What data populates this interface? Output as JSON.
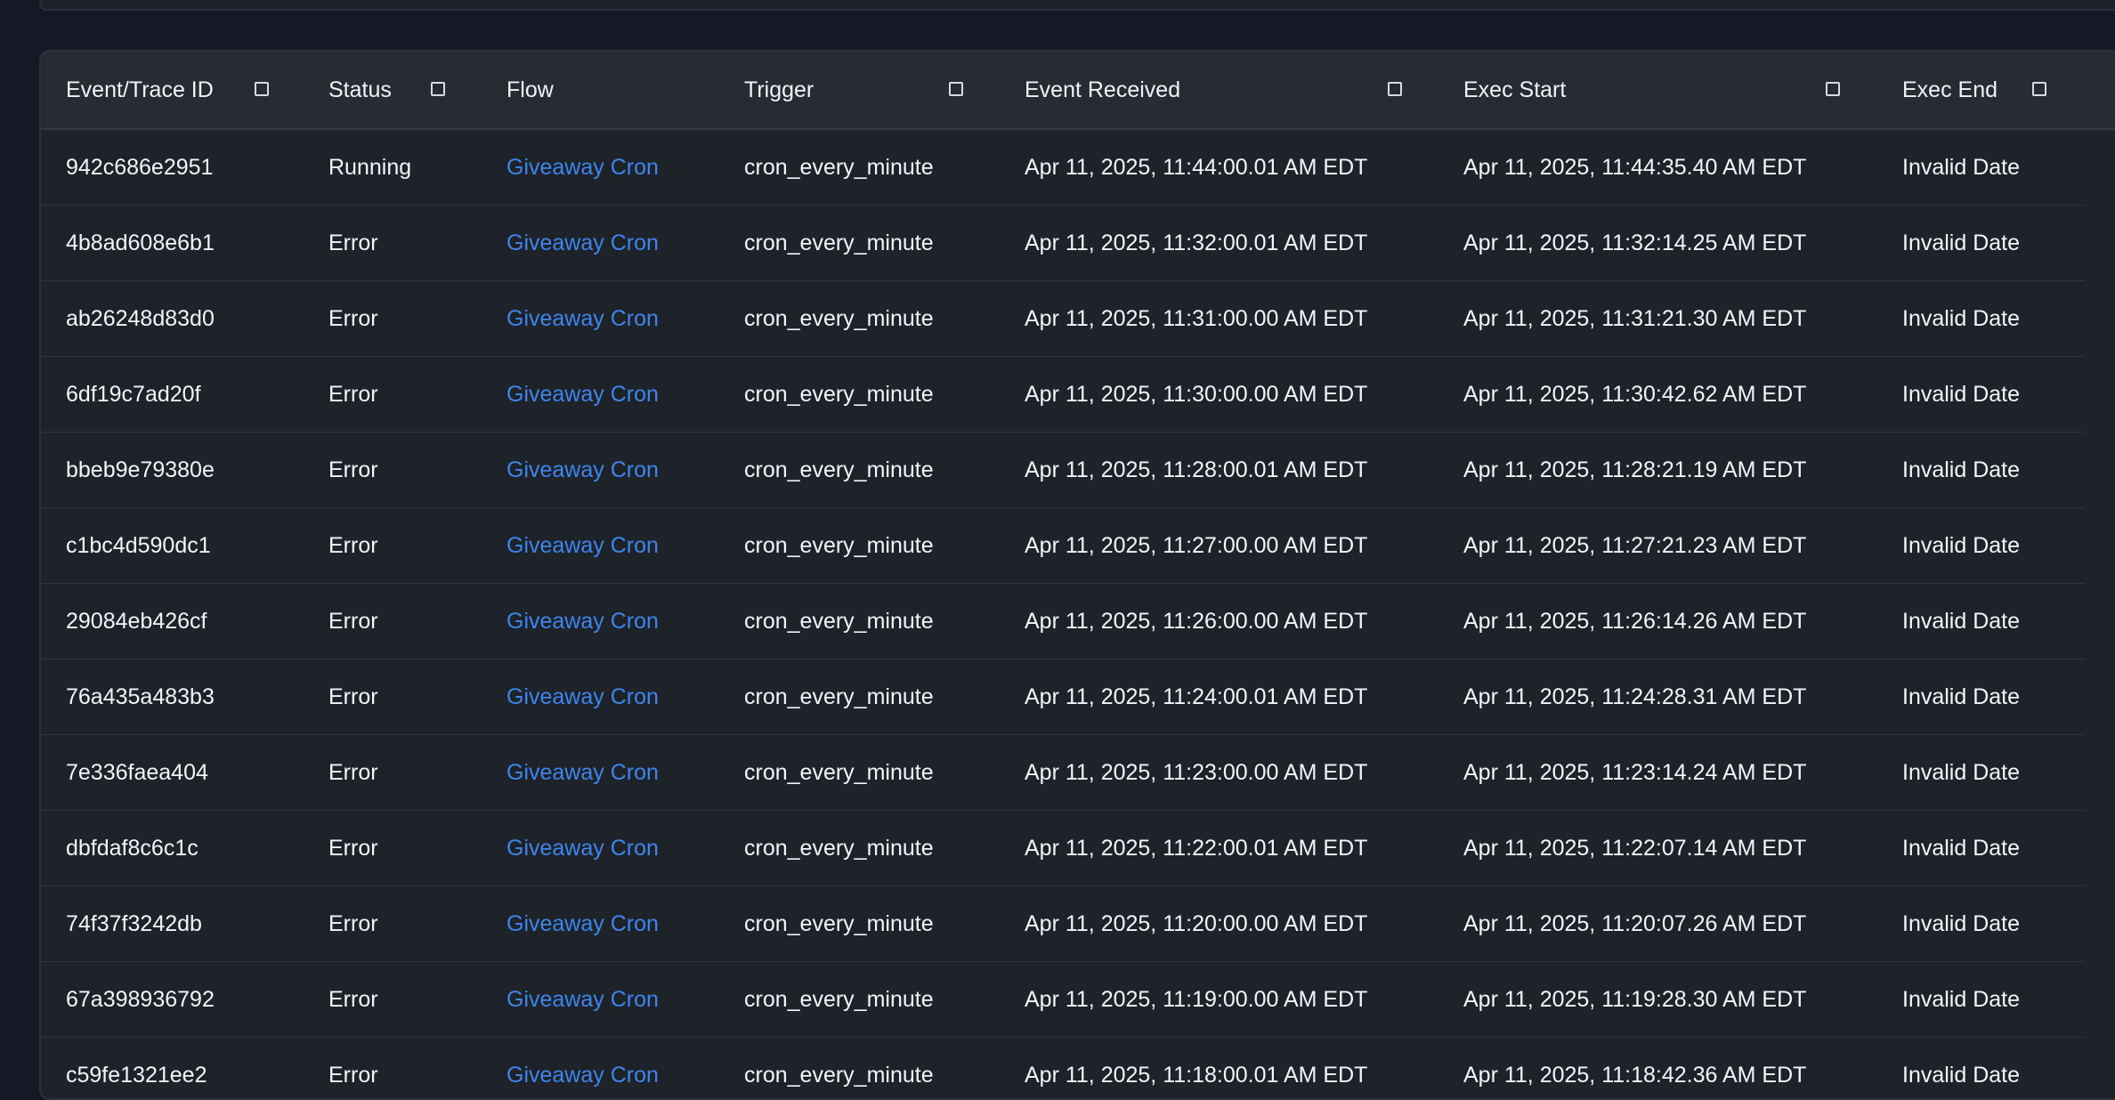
{
  "table": {
    "headers": {
      "id": "Event/Trace ID",
      "status": "Status",
      "flow": "Flow",
      "trigger": "Trigger",
      "received": "Event Received",
      "exec_start": "Exec Start",
      "exec_end": "Exec End"
    },
    "rows": [
      {
        "id": "942c686e2951",
        "status": "Running",
        "flow": "Giveaway Cron",
        "trigger": "cron_every_minute",
        "received": "Apr 11, 2025, 11:44:00.01 AM EDT",
        "exec_start": "Apr 11, 2025, 11:44:35.40 AM EDT",
        "exec_end": "Invalid Date"
      },
      {
        "id": "4b8ad608e6b1",
        "status": "Error",
        "flow": "Giveaway Cron",
        "trigger": "cron_every_minute",
        "received": "Apr 11, 2025, 11:32:00.01 AM EDT",
        "exec_start": "Apr 11, 2025, 11:32:14.25 AM EDT",
        "exec_end": "Invalid Date"
      },
      {
        "id": "ab26248d83d0",
        "status": "Error",
        "flow": "Giveaway Cron",
        "trigger": "cron_every_minute",
        "received": "Apr 11, 2025, 11:31:00.00 AM EDT",
        "exec_start": "Apr 11, 2025, 11:31:21.30 AM EDT",
        "exec_end": "Invalid Date"
      },
      {
        "id": "6df19c7ad20f",
        "status": "Error",
        "flow": "Giveaway Cron",
        "trigger": "cron_every_minute",
        "received": "Apr 11, 2025, 11:30:00.00 AM EDT",
        "exec_start": "Apr 11, 2025, 11:30:42.62 AM EDT",
        "exec_end": "Invalid Date"
      },
      {
        "id": "bbeb9e79380e",
        "status": "Error",
        "flow": "Giveaway Cron",
        "trigger": "cron_every_minute",
        "received": "Apr 11, 2025, 11:28:00.01 AM EDT",
        "exec_start": "Apr 11, 2025, 11:28:21.19 AM EDT",
        "exec_end": "Invalid Date"
      },
      {
        "id": "c1bc4d590dc1",
        "status": "Error",
        "flow": "Giveaway Cron",
        "trigger": "cron_every_minute",
        "received": "Apr 11, 2025, 11:27:00.00 AM EDT",
        "exec_start": "Apr 11, 2025, 11:27:21.23 AM EDT",
        "exec_end": "Invalid Date"
      },
      {
        "id": "29084eb426cf",
        "status": "Error",
        "flow": "Giveaway Cron",
        "trigger": "cron_every_minute",
        "received": "Apr 11, 2025, 11:26:00.00 AM EDT",
        "exec_start": "Apr 11, 2025, 11:26:14.26 AM EDT",
        "exec_end": "Invalid Date"
      },
      {
        "id": "76a435a483b3",
        "status": "Error",
        "flow": "Giveaway Cron",
        "trigger": "cron_every_minute",
        "received": "Apr 11, 2025, 11:24:00.01 AM EDT",
        "exec_start": "Apr 11, 2025, 11:24:28.31 AM EDT",
        "exec_end": "Invalid Date"
      },
      {
        "id": "7e336faea404",
        "status": "Error",
        "flow": "Giveaway Cron",
        "trigger": "cron_every_minute",
        "received": "Apr 11, 2025, 11:23:00.00 AM EDT",
        "exec_start": "Apr 11, 2025, 11:23:14.24 AM EDT",
        "exec_end": "Invalid Date"
      },
      {
        "id": "dbfdaf8c6c1c",
        "status": "Error",
        "flow": "Giveaway Cron",
        "trigger": "cron_every_minute",
        "received": "Apr 11, 2025, 11:22:00.01 AM EDT",
        "exec_start": "Apr 11, 2025, 11:22:07.14 AM EDT",
        "exec_end": "Invalid Date"
      },
      {
        "id": "74f37f3242db",
        "status": "Error",
        "flow": "Giveaway Cron",
        "trigger": "cron_every_minute",
        "received": "Apr 11, 2025, 11:20:00.00 AM EDT",
        "exec_start": "Apr 11, 2025, 11:20:07.26 AM EDT",
        "exec_end": "Invalid Date"
      },
      {
        "id": "67a398936792",
        "status": "Error",
        "flow": "Giveaway Cron",
        "trigger": "cron_every_minute",
        "received": "Apr 11, 2025, 11:19:00.00 AM EDT",
        "exec_start": "Apr 11, 2025, 11:19:28.30 AM EDT",
        "exec_end": "Invalid Date"
      },
      {
        "id": "c59fe1321ee2",
        "status": "Error",
        "flow": "Giveaway Cron",
        "trigger": "cron_every_minute",
        "received": "Apr 11, 2025, 11:18:00.01 AM EDT",
        "exec_start": "Apr 11, 2025, 11:18:42.36 AM EDT",
        "exec_end": "Invalid Date"
      }
    ]
  },
  "colors": {
    "page_bg": "#141925",
    "card_bg": "#1e2229",
    "header_bg": "#272b32",
    "link": "#3d86ee",
    "text": "#f3f5f8"
  },
  "icons": {
    "column_toggle": "checkbox-square-icon"
  }
}
